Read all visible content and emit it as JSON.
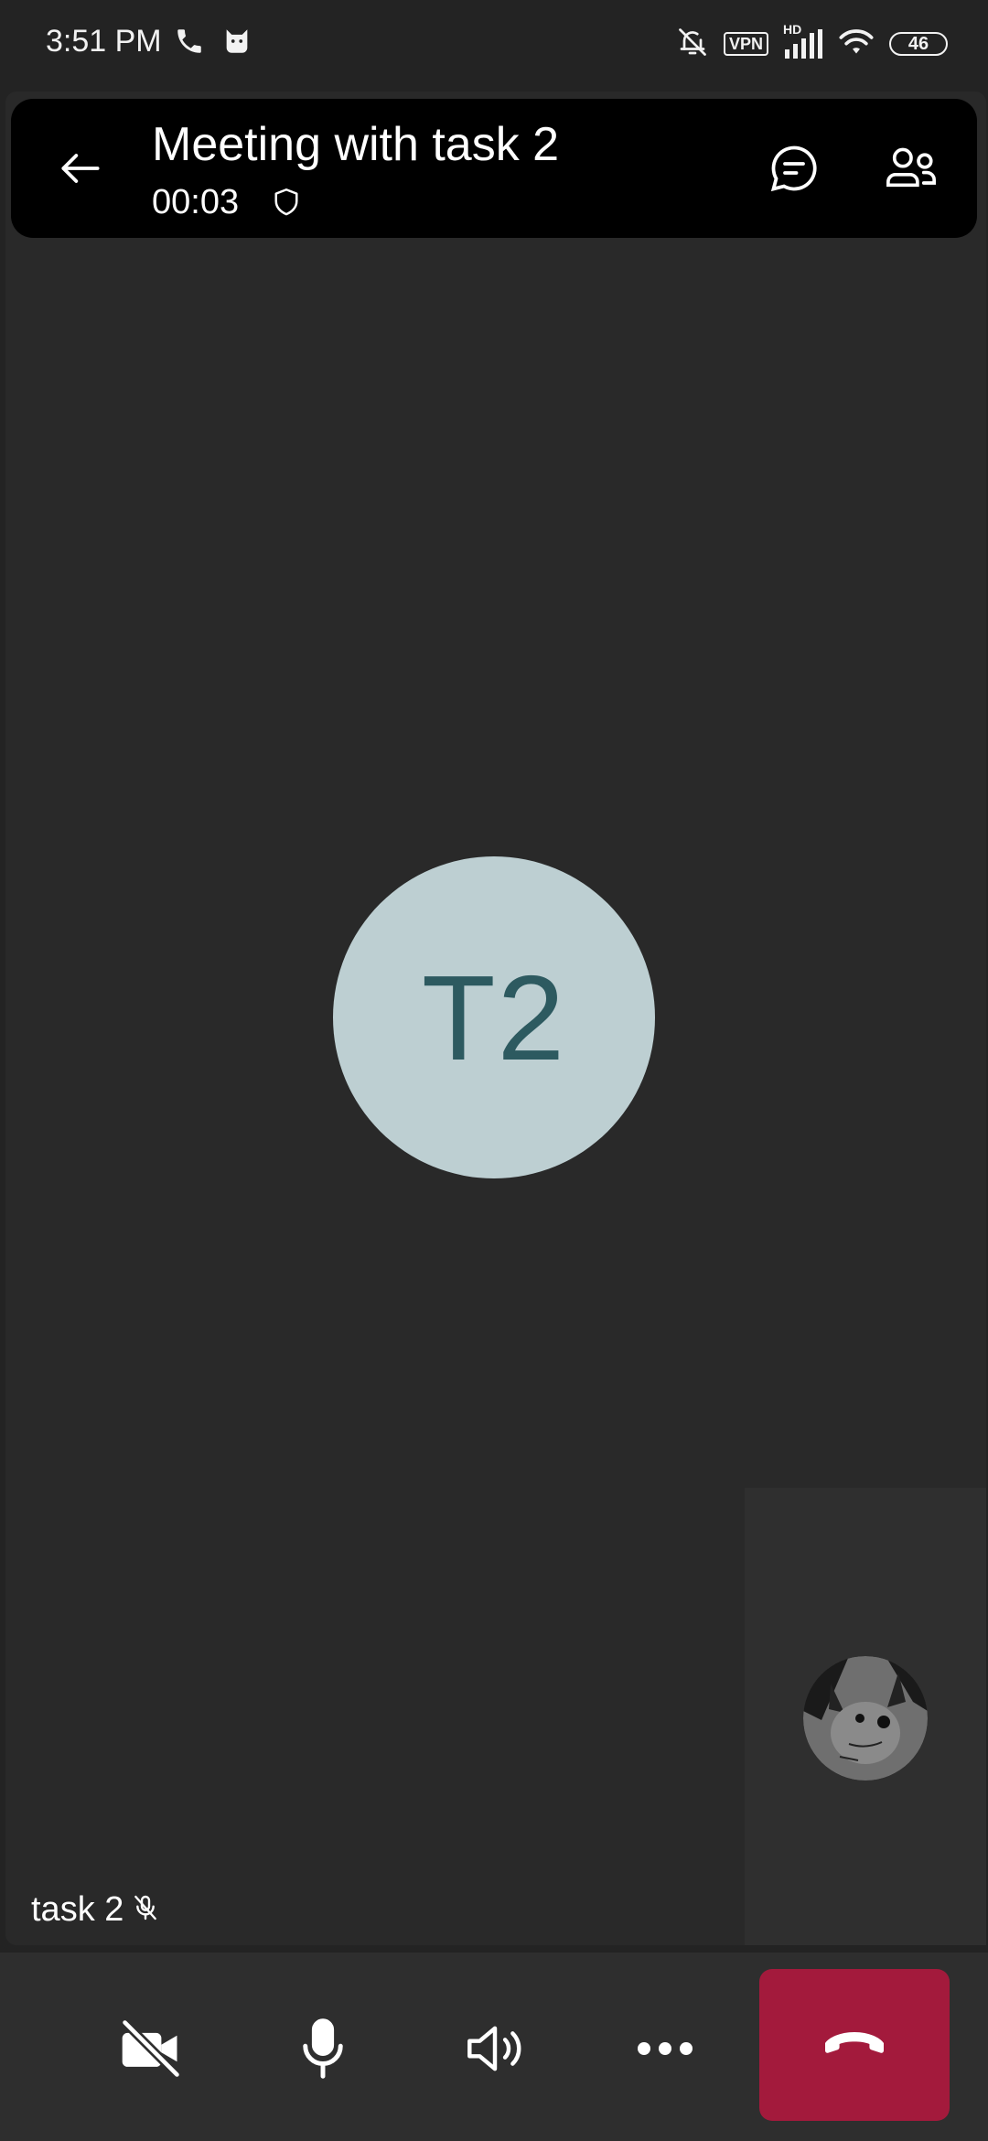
{
  "status_bar": {
    "time": "3:51 PM",
    "vpn_label": "VPN",
    "network_label": "HD",
    "battery_level": "46",
    "icons": [
      "phone-call-icon",
      "cat-icon",
      "bell-muted-icon",
      "vpn-icon",
      "signal-icon",
      "wifi-icon",
      "battery-icon"
    ]
  },
  "header": {
    "title": "Meeting with task 2",
    "timer": "00:03",
    "icons": [
      "back-arrow-icon",
      "shield-icon",
      "chat-icon",
      "participants-icon"
    ]
  },
  "stage": {
    "avatar_initials": "T2",
    "avatar_color": "#bdcfd2",
    "initials_color": "#2d5a60",
    "participant_name": "task 2",
    "participant_muted": true
  },
  "self_preview": {
    "avatar_icon": "self-profile-avatar"
  },
  "controls": {
    "items": [
      "camera-off-icon",
      "microphone-icon",
      "speaker-icon",
      "more-options-icon",
      "end-call-icon"
    ],
    "end_call_color": "#a31a3c"
  },
  "colors": {
    "background": "#232323",
    "stage": "#292929",
    "header": "#000000",
    "control_bar": "#2e2e2e"
  }
}
